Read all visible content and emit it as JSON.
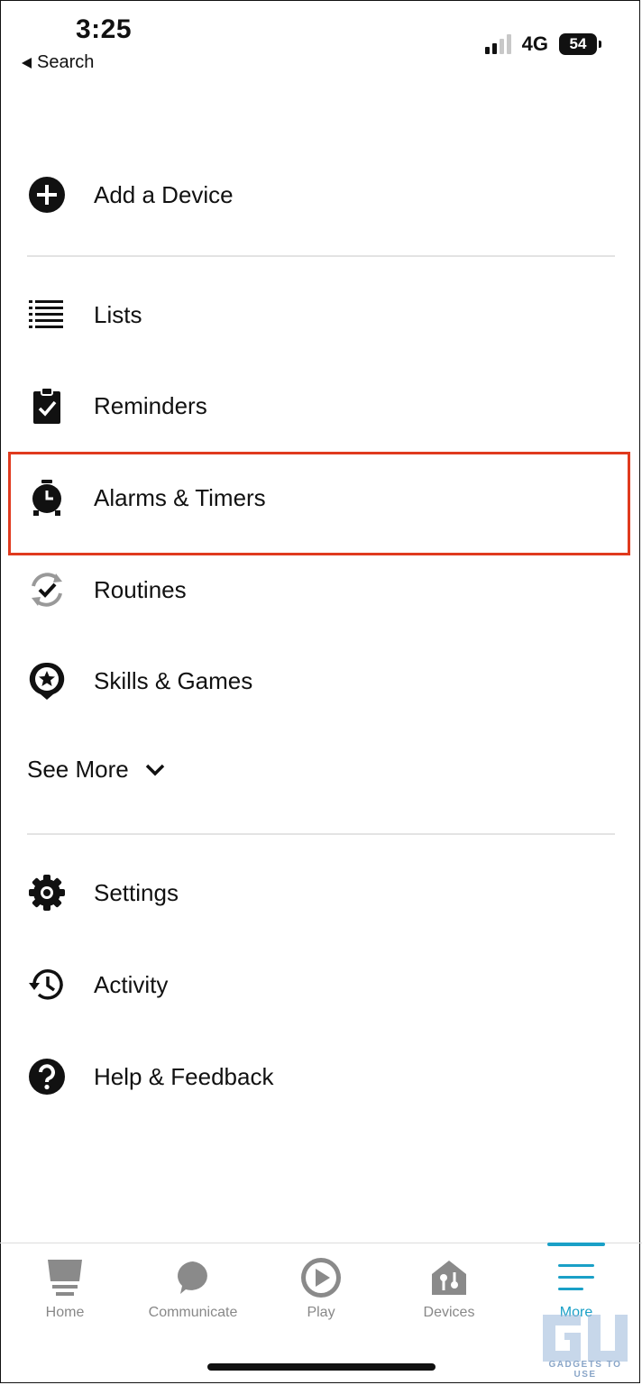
{
  "status_bar": {
    "time": "3:25",
    "back_label": "Search",
    "network": "4G",
    "battery": "54"
  },
  "menu": {
    "add_device": "Add a Device",
    "lists": "Lists",
    "reminders": "Reminders",
    "alarms": "Alarms & Timers",
    "routines": "Routines",
    "skills": "Skills & Games",
    "see_more": "See More",
    "settings": "Settings",
    "activity": "Activity",
    "help": "Help & Feedback"
  },
  "tabs": {
    "home": "Home",
    "communicate": "Communicate",
    "play": "Play",
    "devices": "Devices",
    "more": "More"
  },
  "watermark": {
    "text": "GADGETS TO USE"
  },
  "colors": {
    "accent": "#1aa0c7",
    "highlight": "#e03a1e"
  }
}
